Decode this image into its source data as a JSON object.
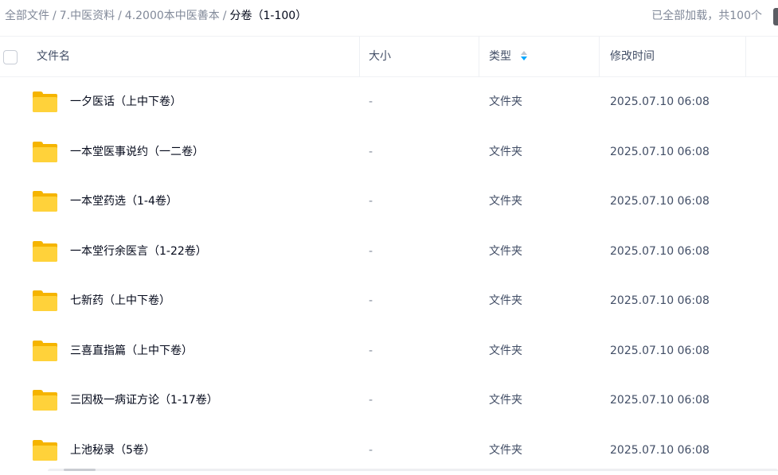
{
  "breadcrumb": {
    "items": [
      "全部文件",
      "7.中医资料",
      "4.2000本中医善本"
    ],
    "current": "分卷（1-100）",
    "separator": "/"
  },
  "status": "已全部加载，共100个",
  "columns": {
    "name": "文件名",
    "size": "大小",
    "type": "类型",
    "modified": "修改时间"
  },
  "sort": {
    "column": "type",
    "direction": "descending"
  },
  "icons": {
    "row_icon": "folder-icon",
    "sort_icon": "sort-icon"
  },
  "colors": {
    "accent": "#06a7ff",
    "folder": "#ffd23a",
    "text_primary": "#03081a",
    "text_secondary": "#818999"
  },
  "rows": [
    {
      "name": "一夕医话（上中下卷）",
      "size": "-",
      "type": "文件夹",
      "modified": "2025.07.10 06:08"
    },
    {
      "name": "一本堂医事说约（一二卷）",
      "size": "-",
      "type": "文件夹",
      "modified": "2025.07.10 06:08"
    },
    {
      "name": "一本堂药选（1-4卷）",
      "size": "-",
      "type": "文件夹",
      "modified": "2025.07.10 06:08"
    },
    {
      "name": "一本堂行余医言（1-22卷）",
      "size": "-",
      "type": "文件夹",
      "modified": "2025.07.10 06:08"
    },
    {
      "name": "七新药（上中下卷）",
      "size": "-",
      "type": "文件夹",
      "modified": "2025.07.10 06:08"
    },
    {
      "name": "三喜直指篇（上中下卷）",
      "size": "-",
      "type": "文件夹",
      "modified": "2025.07.10 06:08"
    },
    {
      "name": "三因极一病证方论（1-17卷）",
      "size": "-",
      "type": "文件夹",
      "modified": "2025.07.10 06:08"
    },
    {
      "name": "上池秘录（5卷）",
      "size": "-",
      "type": "文件夹",
      "modified": "2025.07.10 06:08"
    }
  ]
}
